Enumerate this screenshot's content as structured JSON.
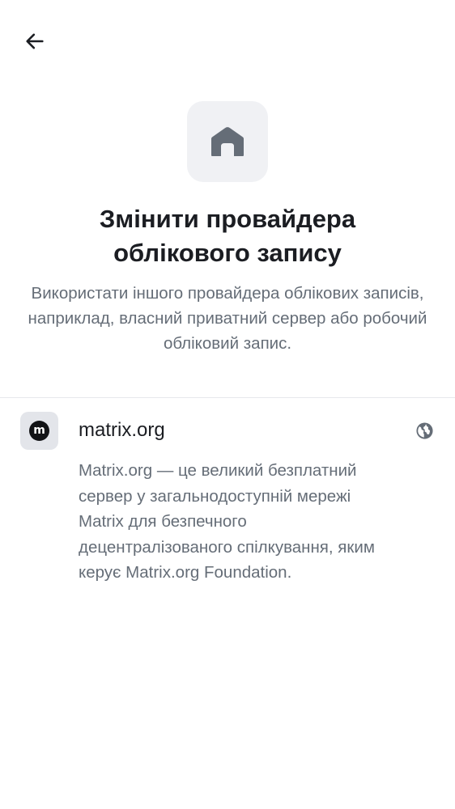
{
  "header": {
    "back_icon": "arrow-left-icon"
  },
  "hero": {
    "icon": "home-icon",
    "title": "Змінити провайдера облікового запису",
    "subtitle": "Використати іншого провайдера облікових записів, наприклад, власний приватний сервер або робочий обліковий запис."
  },
  "provider": {
    "logo_icon": "matrix-logo-icon",
    "logo_text": "m",
    "name": "matrix.org",
    "trailing_icon": "globe-icon",
    "description": "Matrix.org — це великий безплатний сервер у загальнодоступній мережі Matrix для безпечного децентралізованого спілкування, яким керує Matrix.org Foundation."
  },
  "colors": {
    "background": "#ffffff",
    "text_primary": "#1b1d22",
    "text_secondary": "#656d77",
    "icon_tile": "#f0f1f4",
    "icon_grey": "#656d77",
    "divider": "#e7e8ec"
  }
}
